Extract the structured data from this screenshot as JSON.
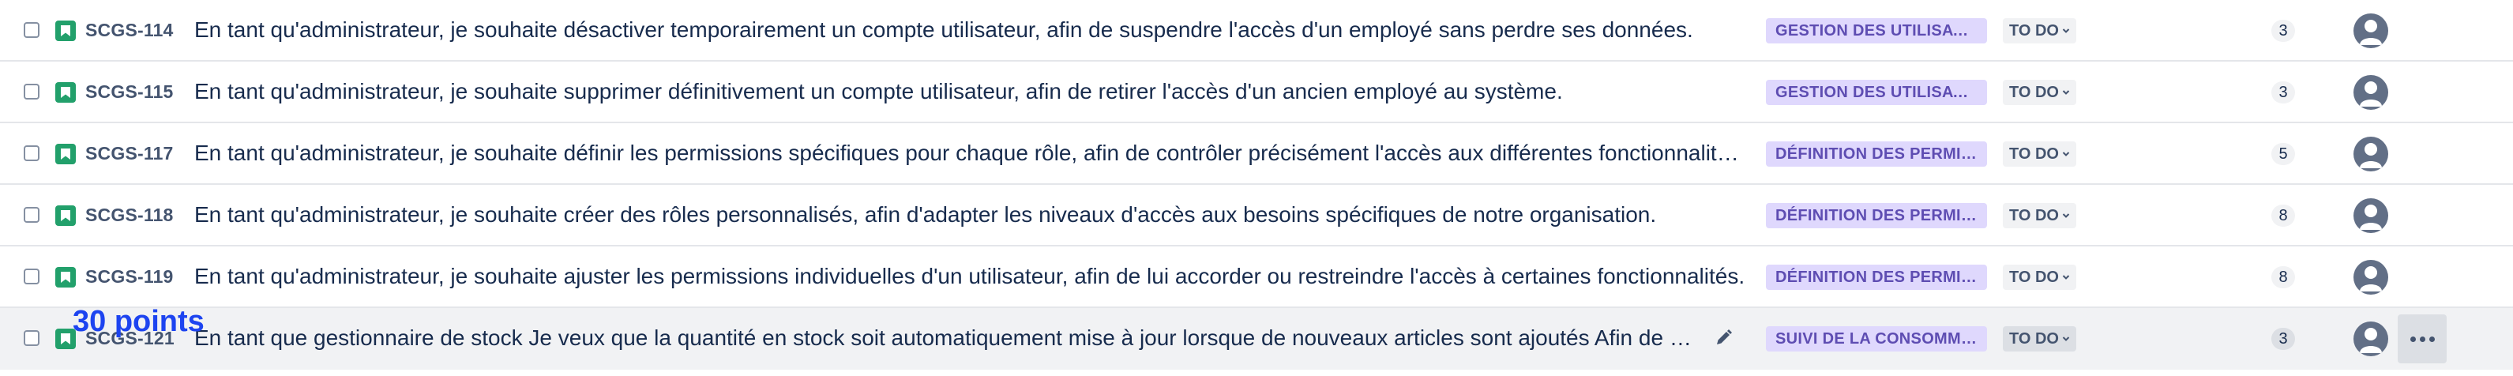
{
  "backlog": {
    "rows": [
      {
        "key": "SCGS-114",
        "summary": "En tant qu'administrateur, je souhaite désactiver temporairement un compte utilisateur, afin de suspendre l'accès d'un employé sans perdre ses données.",
        "epic": "GESTION DES UTILISATEURS",
        "status": "TO DO",
        "story_points": "3"
      },
      {
        "key": "SCGS-115",
        "summary": "En tant qu'administrateur, je souhaite supprimer définitivement un compte utilisateur, afin de retirer l'accès d'un ancien employé au système.",
        "epic": "GESTION DES UTILISATEURS",
        "status": "TO DO",
        "story_points": "3"
      },
      {
        "key": "SCGS-117",
        "summary": "En tant qu'administrateur, je souhaite définir les permissions spécifiques pour chaque rôle, afin de contrôler précisément l'accès aux différentes fonctionnalités.",
        "epic": "DÉFINITION DES PERMISSIONS",
        "status": "TO DO",
        "story_points": "5"
      },
      {
        "key": "SCGS-118",
        "summary": "En tant qu'administrateur, je souhaite créer des rôles personnalisés, afin d'adapter les niveaux d'accès aux besoins spécifiques de notre organisation.",
        "epic": "DÉFINITION DES PERMISSIONS",
        "status": "TO DO",
        "story_points": "8"
      },
      {
        "key": "SCGS-119",
        "summary": "En tant qu'administrateur, je souhaite ajuster les permissions individuelles d'un utilisateur, afin de lui accorder ou restreindre l'accès à certaines fonctionnalités.",
        "epic": "DÉFINITION DES PERMISSIONS",
        "status": "TO DO",
        "story_points": "8"
      },
      {
        "key": "SCGS-121",
        "summary": "En tant que gestionnaire de stock Je veux que la quantité en stock soit automatiquement mise à jour lorsque de nouveaux articles sont ajoutés Afin de maintenir un inventaire précis.",
        "epic": "SUIVI DE LA CONSOMMATION",
        "status": "TO DO",
        "story_points": "3"
      }
    ]
  },
  "overlay": {
    "points_label": "30 points"
  },
  "icons": {
    "issue_type": "story-icon",
    "edit": "pencil-icon",
    "assignee": "default-avatar-icon",
    "more": "more-actions-icon",
    "status_dropdown": "chevron-down-icon"
  },
  "colors": {
    "story_icon": "#22a06b",
    "epic_background": "#dfd8fd",
    "epic_text": "#5e4db2",
    "points_overlay": "#1d44f0",
    "hover_row": "#f1f2f4"
  }
}
